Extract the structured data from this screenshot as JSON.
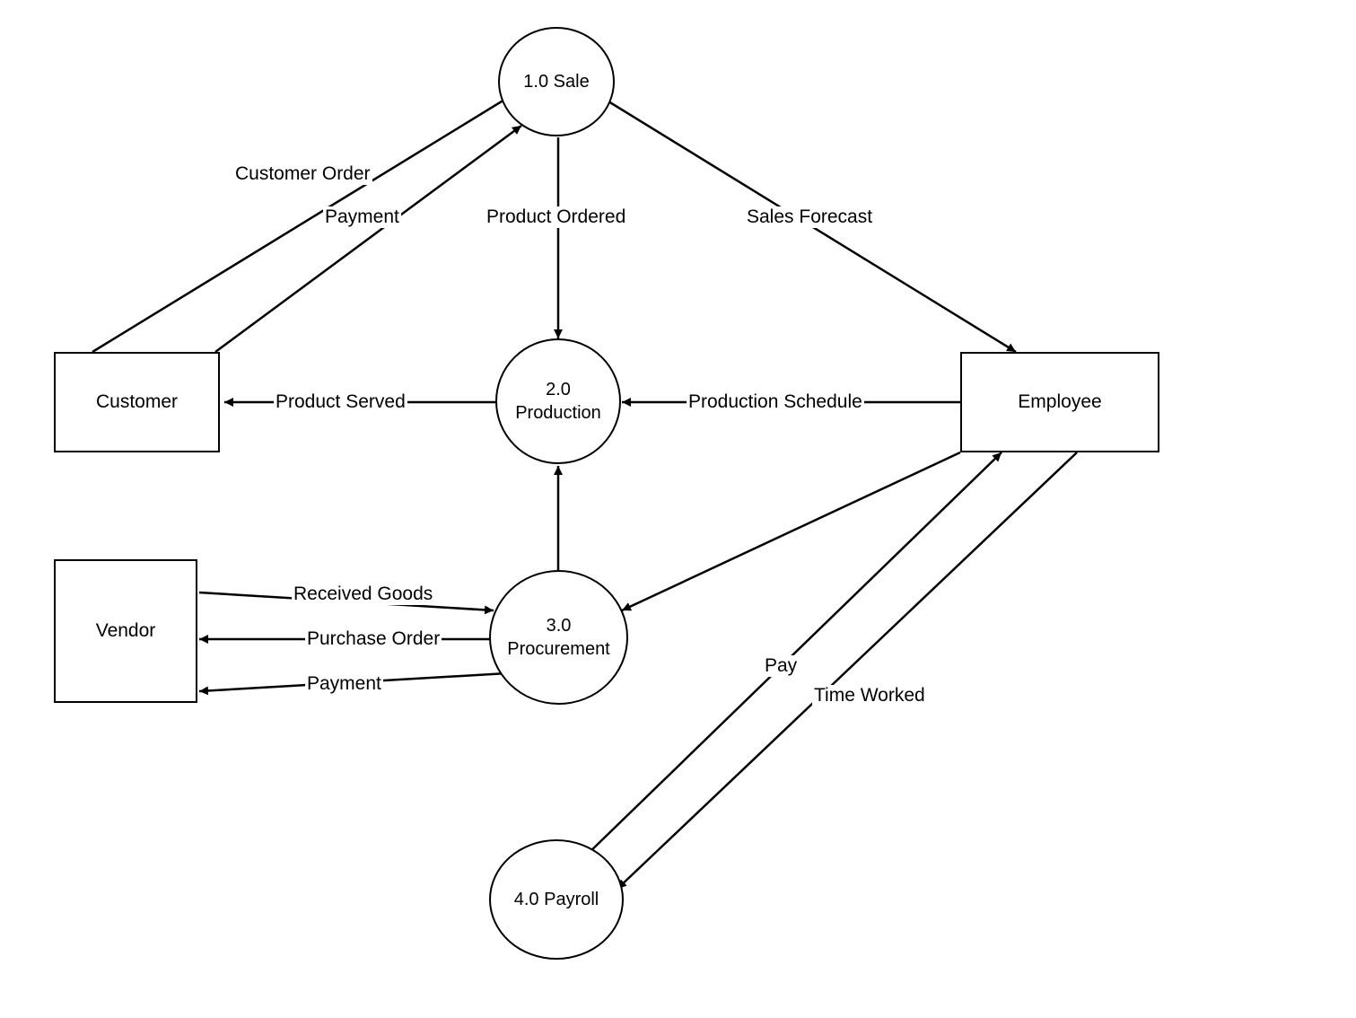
{
  "entities": {
    "customer": "Customer",
    "vendor": "Vendor",
    "employee": "Employee"
  },
  "processes": {
    "sale": "1.0 Sale",
    "production": "2.0\nProduction",
    "procurement": "3.0\nProcurement",
    "payroll": "4.0 Payroll"
  },
  "flows": {
    "customer_order": "Customer Order",
    "payment_to_sale": "Payment",
    "product_ordered": "Product Ordered",
    "sales_forecast": "Sales Forecast",
    "product_served": "Product Served",
    "production_schedule": "Production Schedule",
    "received_goods": "Received Goods",
    "purchase_order": "Purchase Order",
    "payment_to_vendor": "Payment",
    "pay": "Pay",
    "time_worked": "Time Worked"
  }
}
